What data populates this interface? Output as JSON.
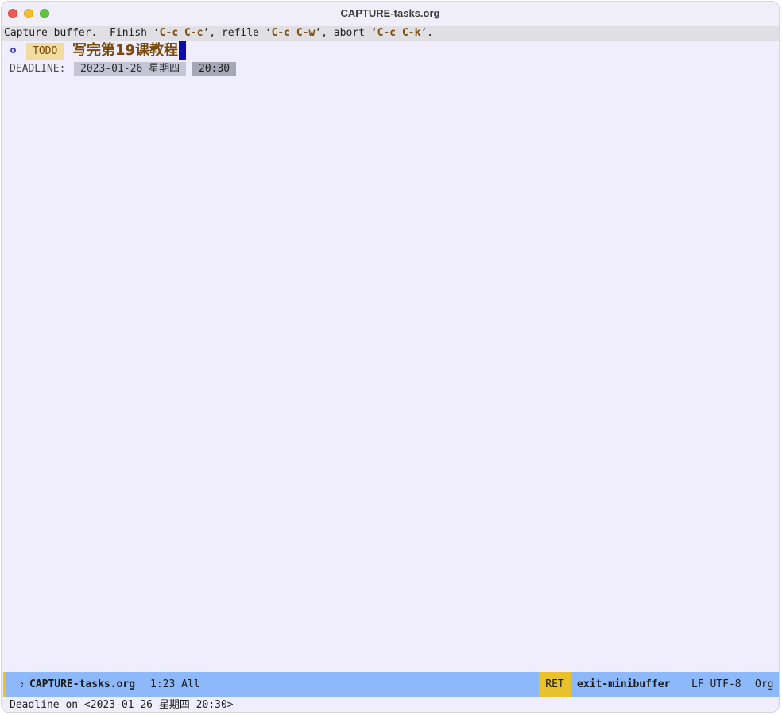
{
  "window": {
    "title": "CAPTURE-tasks.org"
  },
  "header": {
    "prefix": "Capture buffer.  Finish ‘",
    "finish_key": "C-c C-c",
    "mid1": "’, refile ‘",
    "refile_key": "C-c C-w",
    "mid2": "’, abort ‘",
    "abort_key": "C-c C-k",
    "suffix": "’."
  },
  "entry": {
    "keyword": "TODO",
    "title": "写完第19课教程",
    "deadline_label": "DEADLINE:",
    "deadline_date": "2023-01-26 星期四",
    "deadline_time": "20:30"
  },
  "modeline": {
    "arrows": "⇕",
    "buffer": "CAPTURE-tasks.org",
    "position": "1:23 All",
    "key": "RET",
    "command": "exit-minibuffer",
    "encoding": "LF UTF-8",
    "mode": "Org"
  },
  "echo": {
    "text": "Deadline on <2023-01-26 星期四 20:30>"
  },
  "colors": {
    "background": "#f0eefc",
    "keyword_bg": "#f3dca0",
    "heading_fg": "#7a4a0a",
    "cursor": "#0c0ca8",
    "modeline_bg": "#8db8fa",
    "highlight": "#e8c12c"
  }
}
